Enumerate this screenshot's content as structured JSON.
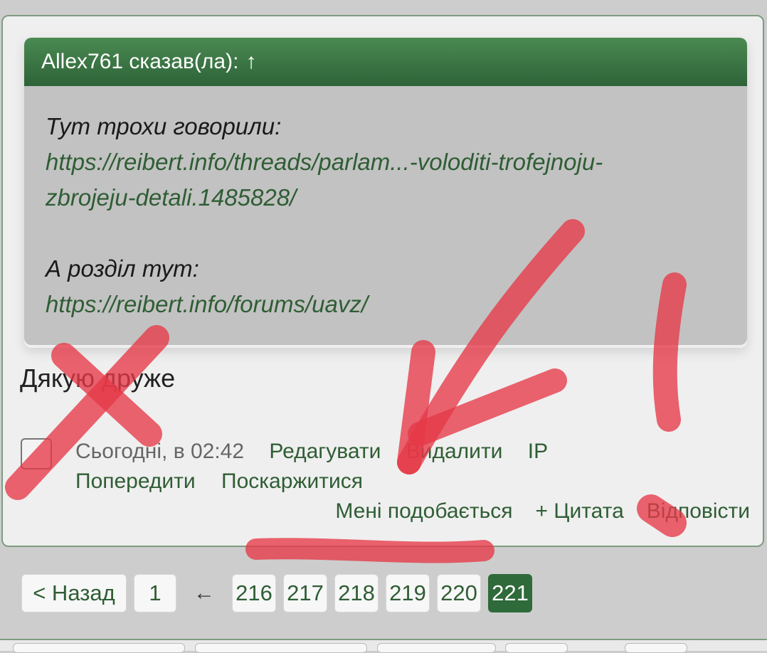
{
  "quote": {
    "author": "Allex761 сказав(ла):",
    "arrow": "↑",
    "line1": "Тут трохи говорили:",
    "link1_part1": "https://reibert.info/threads/parlam...-voloditi-trofejnoju-",
    "link1_part2": "zbrojeju-detali.1485828/",
    "line2": "А розділ тут:",
    "link2": "https://reibert.info/forums/uavz/"
  },
  "message": "Дякую друже",
  "post_meta": {
    "date": "Сьогодні, в 02:42",
    "edit": "Редагувати",
    "delete": "Видалити",
    "ip": "IP",
    "warn": "Попередити",
    "report": "Поскаржитися"
  },
  "post_footer": {
    "like": "Мені подобається",
    "quote": "+ Цитата",
    "reply": "Відповісти"
  },
  "pagination": {
    "prev": "< Назад",
    "first": "1",
    "gap": "←",
    "pages": [
      "216",
      "217",
      "218",
      "219",
      "220"
    ],
    "current": "221"
  },
  "colors": {
    "accent": "#2f5d34",
    "header_green": "#3d7a46",
    "annotation_red": "#e63946"
  }
}
